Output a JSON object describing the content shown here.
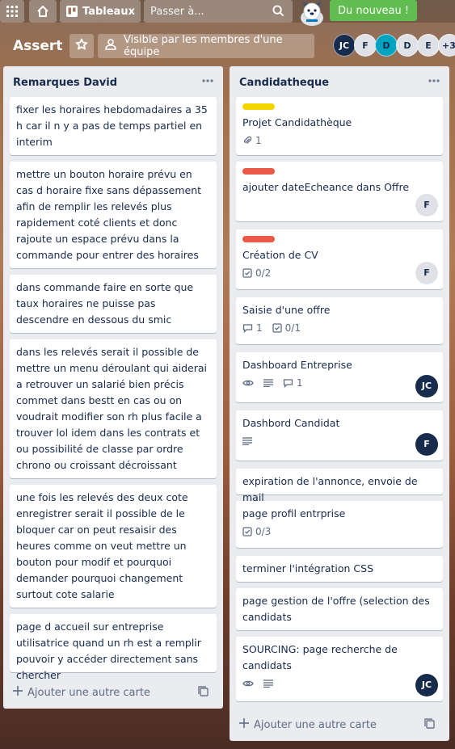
{
  "topbar": {
    "boards_label": "Tableaux",
    "search_placeholder": "Passer à...",
    "new_badge": "Du nouveau !"
  },
  "board": {
    "title": "Assert",
    "visibility_label": "Visible par les membres d'une équipe",
    "members": [
      "JC",
      "F",
      "D",
      "D",
      "E"
    ],
    "more_members": "+3"
  },
  "lists": [
    {
      "title": "Remarques David",
      "add_card_label": "Ajouter une autre carte",
      "cards": [
        {
          "text": "fixer les horaires hebdomadaires a 35 h car il n y a pas de temps partiel en interim"
        },
        {
          "text": "mettre un bouton horaire prévu en cas d horaire fixe sans dépassement afin de remplir les relevés plus rapidement coté clients et donc rajoute un espace prévu dans la commande pour entrer des horaires"
        },
        {
          "text": "dans commande faire en sorte que taux horaires ne puisse pas descendre en dessous du smic"
        },
        {
          "text": "dans les relevés serait il possible de mettre un menu déroulant qui aiderai a retrouver un salarié bien précis commet dans bestt en cas ou on voudrait modifier son rh plus facile a trouver lol idem dans les contrats et ou possibilité de classe par ordre chrono ou croissant décroissant"
        },
        {
          "text": "une fois les relevés des deux cote enregistrer serait il possible de le bloquer car on peut resaisir des heures comme on veut mettre un bouton pour modif et pourquoi demander pourquoi changement surtout cote salarie"
        },
        {
          "text": "page d accueil sur entreprise utilisatrice quand un rh est a remplir pouvoir y accéder directement sans chercher"
        }
      ]
    },
    {
      "title": "Candidatheque",
      "add_card_label": "Ajouter une autre carte",
      "cards": [
        {
          "text": "Projet Candidathèque",
          "label_color": "#f2d600",
          "attachments": "1"
        },
        {
          "text": "ajouter dateEcheance dans Offre",
          "label_color": "#eb5a46",
          "member": "F"
        },
        {
          "text": "Création de CV",
          "label_color": "#eb5a46",
          "checklist": "0/2",
          "member": "F"
        },
        {
          "text": "Saisie d'une offre",
          "comments": "1",
          "checklist": "0/1"
        },
        {
          "text": "Dashboard Entreprise",
          "comments": "1",
          "member": "JC"
        },
        {
          "text": "Dashbord Candidat",
          "member": "F"
        },
        {
          "text": "expiration de l'annonce, envoie de mail"
        },
        {
          "text": "page profil entrprise",
          "checklist": "0/3"
        },
        {
          "text": "terminer l'intégration CSS"
        },
        {
          "text": "page gestion de l'offre (selection des candidats"
        },
        {
          "text": "SOURCING: page recherche de candidats",
          "member": "JC"
        }
      ]
    }
  ],
  "colors": {
    "list_bg": "#ebecf0",
    "label_yellow": "#f2d600",
    "label_red": "#eb5a46",
    "new_badge": "#61bd4f",
    "avatar_dark": "#172b4d"
  }
}
